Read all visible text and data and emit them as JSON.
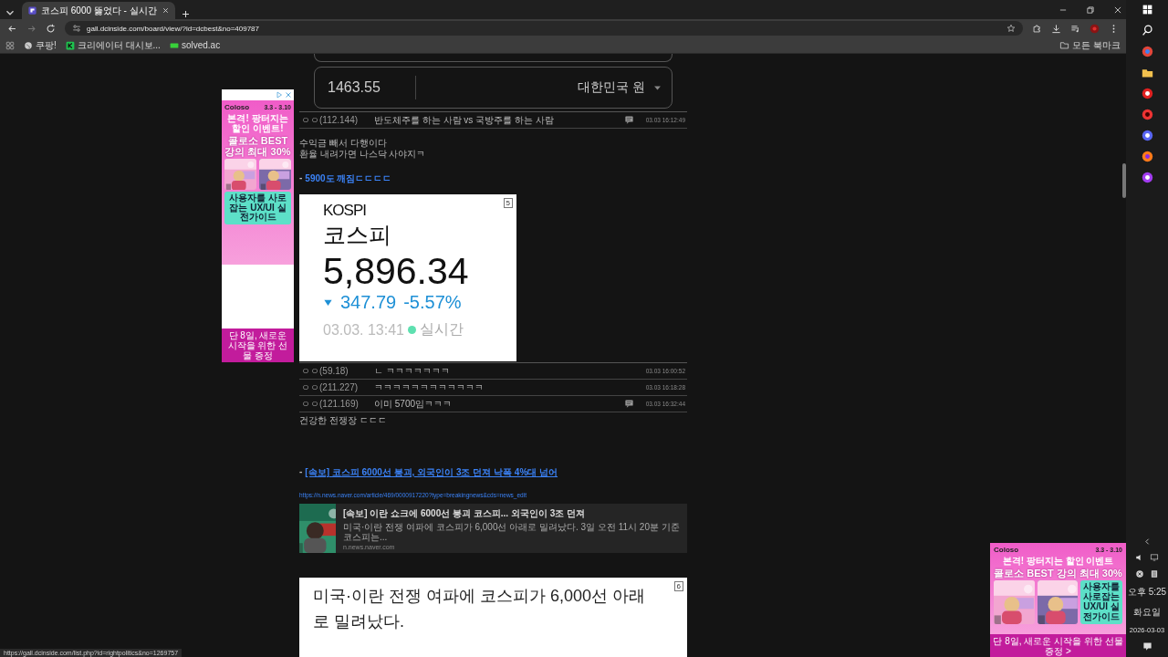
{
  "browser": {
    "tabs": [
      {
        "title": "코스피 6000 뚫었다 - 실시간",
        "selected": true
      }
    ],
    "address": "gall.dcinside.com/board/view/?id=dcbest&no=409787",
    "bookmarks": [
      {
        "label": "쿠팡!",
        "kind": "globe"
      },
      {
        "label": "크리에이터 대시보...",
        "kind": "k"
      },
      {
        "label": "solved.ac",
        "kind": "bar"
      }
    ],
    "all_bookmarks": "모든 북마크"
  },
  "converter": {
    "amount": "1463.55",
    "currency": "대한민국 원"
  },
  "comments_top": [
    {
      "author": "ㅇㅇ(112.144)",
      "text": "반도체주를 하는 사람 vs 국방주를 하는 사람",
      "time": "03.03 16:12:49",
      "has_image": true
    }
  ],
  "body_lines": [
    "수익금 빼서 다행이다",
    "환율 내려가면 나스닥 사야지ㅋ"
  ],
  "link": {
    "prefix": "-",
    "text": "5900도 깨짐ㄷㄷㄷㄷ"
  },
  "kospi_card": {
    "badge": "5",
    "name_en": "KOSPI",
    "name_ko": "코스피",
    "value": "5,896.34",
    "change": "347.79",
    "change_pct": "-5.57%",
    "timestamp": "03.03. 13:41",
    "live": "실시간"
  },
  "comments": [
    {
      "author": "ㅇㅇ(59.18)",
      "text": "ㄴ ㅋㅋㅋㅋㅋㅋㅋ",
      "time": "03.03 16:00:52",
      "has_image": false
    },
    {
      "author": "ㅇㅇ(211.227)",
      "text": "ㅋㅋㅋㅋㅋㅋㅋㅋㅋㅋㅋㅋ",
      "time": "03.03 16:18:28",
      "has_image": false
    },
    {
      "author": "ㅇㅇ(121.169)",
      "text": "이미 5700임ㅋㅋㅋ",
      "time": "03.03 16:32:44",
      "has_image": true
    }
  ],
  "note": "건강한 전쟁장 ㄷㄷㄷ",
  "news": {
    "prefix": "-",
    "headline": "[속보] 코스피 6000선 붕괴, 외국인이 3조 던져 낙폭 4%대 넘어",
    "url": "https://n.news.naver.com/article/469/0000917220?type=breakingnews&cds=news_edit",
    "preview": {
      "title": "[속보] 이란 쇼크에 6000선 붕괴 코스피... 외국인이 3조 던져",
      "snippet": "미국·이란 전쟁 여파에 코스피가 6,000선 아래로 밀려났다. 3일 오전 11시 20분 기준 코스피는...",
      "domain": "n.news.naver.com"
    }
  },
  "article": {
    "badge": "6",
    "text": "미국·이란 전쟁 여파에 코스피가 6,000선 아래로 밀려났다."
  },
  "status_url": "https://gall.dcinside.com/list.php?id=rightpolitics&no=1269757",
  "left_ad": {
    "brand": "Coloso",
    "dates": "3.3 - 3.10",
    "headline": "본격! 팡터지는 할인 이벤트!",
    "title": "콜로소 BEST 강의 최대 30%",
    "promo": "사용자를 사로잡는 UX/UI 실전가이드",
    "footer": "단 8일, 새로운 시작을 위한 선물 증정"
  },
  "right_ad": {
    "brand": "Coloso",
    "dates": "3.3 - 3.10",
    "headline": "본격! 팡터지는 할인 이벤트",
    "title": "콜로소 BEST 강의 최대 30%",
    "promo": "사용자를 사로잡는 UX/UI 실전가이드",
    "footer": "단 8일, 새로운 시작을 위한 선물 증정 >"
  },
  "taskbar": {
    "time": "오후 5:25",
    "weekday": "화요일",
    "date": "2026-03-03"
  }
}
